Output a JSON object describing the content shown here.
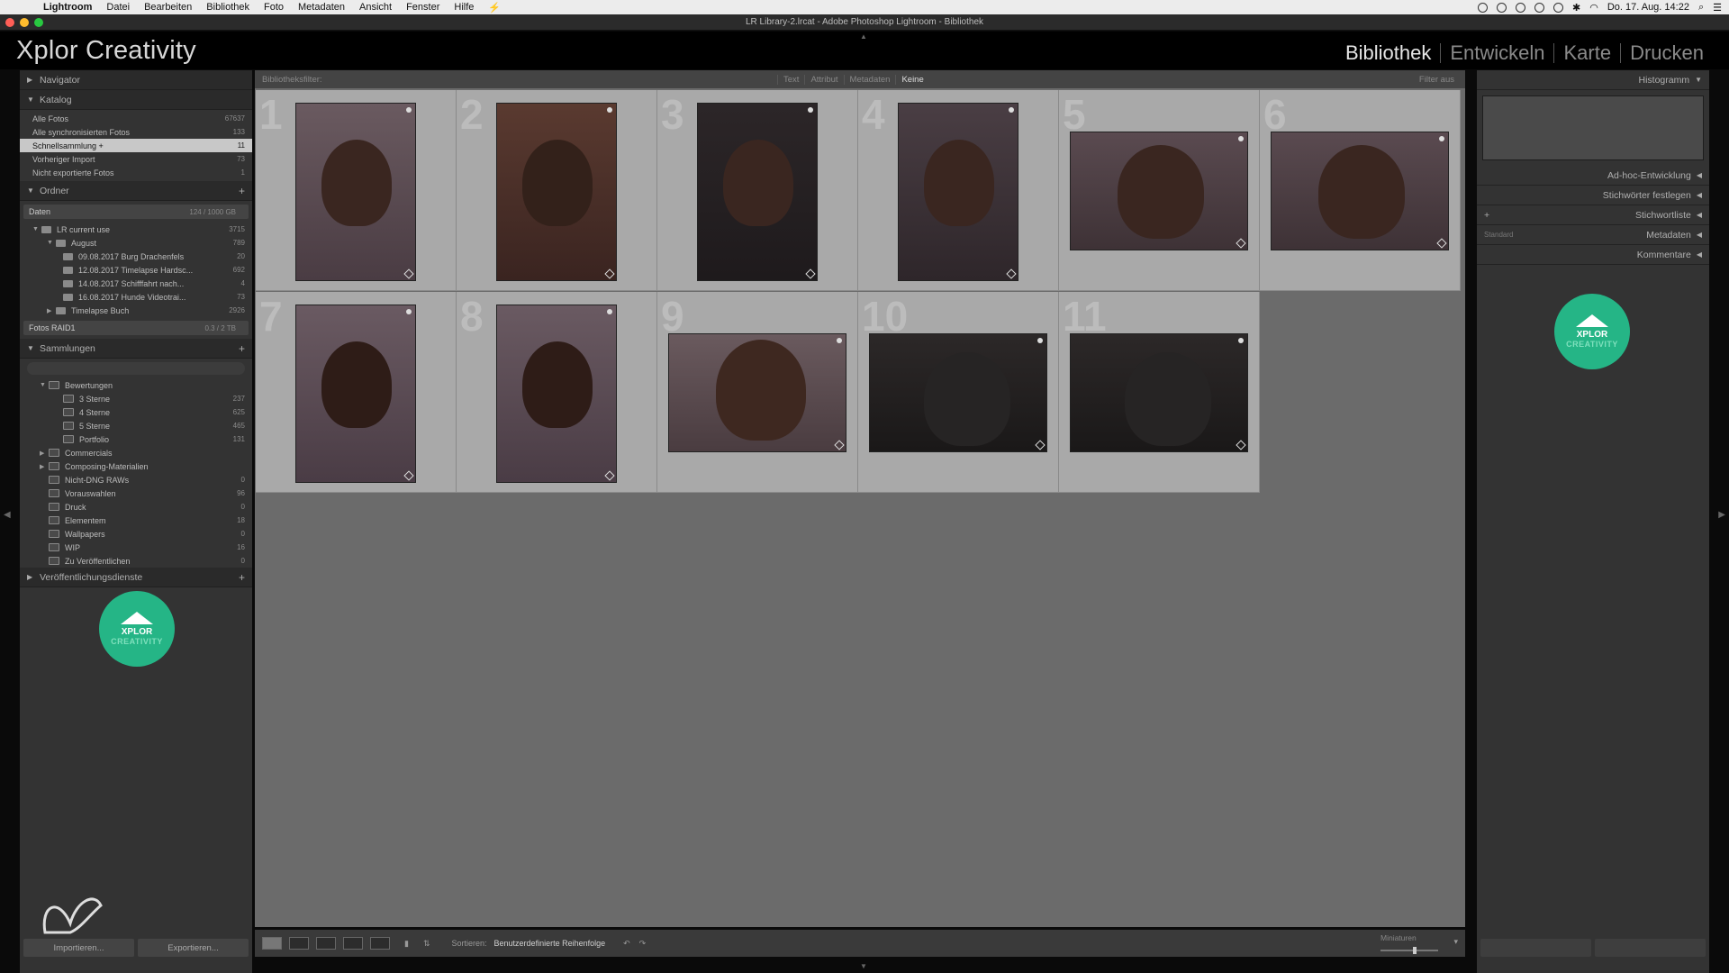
{
  "menubar": {
    "items": [
      "Lightroom",
      "Datei",
      "Bearbeiten",
      "Bibliothek",
      "Foto",
      "Metadaten",
      "Ansicht",
      "Fenster",
      "Hilfe"
    ],
    "clock": "Do. 17. Aug. 14:22"
  },
  "window": {
    "title": "LR Library-2.lrcat - Adobe Photoshop Lightroom - Bibliothek"
  },
  "identity": {
    "brand": "Xplor Creativity",
    "modules": [
      "Bibliothek",
      "Entwickeln",
      "Karte",
      "Drucken"
    ]
  },
  "left": {
    "navigator": "Navigator",
    "katalog": {
      "title": "Katalog",
      "items": [
        {
          "label": "Alle Fotos",
          "count": "67637"
        },
        {
          "label": "Alle synchronisierten Fotos",
          "count": "133"
        },
        {
          "label": "Schnellsammlung +",
          "count": "11"
        },
        {
          "label": "Vorheriger Import",
          "count": "73"
        },
        {
          "label": "Nicht exportierte Fotos",
          "count": "1"
        }
      ]
    },
    "ordner": {
      "title": "Ordner",
      "volume1": {
        "label": "Daten",
        "count": "124 / 1000 GB"
      },
      "items": [
        {
          "label": "LR current use",
          "count": "3715"
        },
        {
          "label": "August",
          "count": "789"
        },
        {
          "label": "09.08.2017 Burg Drachenfels",
          "count": "20"
        },
        {
          "label": "12.08.2017 Timelapse Hardsc...",
          "count": "692"
        },
        {
          "label": "14.08.2017 Schifffahrt nach...",
          "count": "4"
        },
        {
          "label": "16.08.2017 Hunde Videotrai...",
          "count": "73"
        },
        {
          "label": "Timelapse Buch",
          "count": "2926"
        }
      ],
      "volume2": {
        "label": "Fotos RAID1",
        "count": "0.3 / 2 TB"
      }
    },
    "sammlungen": {
      "title": "Sammlungen",
      "items": [
        {
          "label": "Bewertungen",
          "count": ""
        },
        {
          "label": "3 Sterne",
          "count": "237"
        },
        {
          "label": "4 Sterne",
          "count": "625"
        },
        {
          "label": "5 Sterne",
          "count": "465"
        },
        {
          "label": "Portfolio",
          "count": "131"
        },
        {
          "label": "Commercials",
          "count": ""
        },
        {
          "label": "Composing-Materialien",
          "count": ""
        },
        {
          "label": "Nicht-DNG RAWs",
          "count": "0"
        },
        {
          "label": "Vorauswahlen",
          "count": "96"
        },
        {
          "label": "Druck",
          "count": "0"
        },
        {
          "label": "Elementem",
          "count": "18"
        },
        {
          "label": "Wallpapers",
          "count": "0"
        },
        {
          "label": "WIP",
          "count": "16"
        },
        {
          "label": "Zu Veröffentlichen",
          "count": "0"
        }
      ]
    },
    "publish": "Veröffentlichungsdienste",
    "logo": {
      "line1": "XPLOR",
      "line2": "CREATIVITY"
    },
    "import_btn": "Importieren...",
    "export_btn": "Exportieren..."
  },
  "filter": {
    "label": "Bibliotheksfilter:",
    "tabs": [
      "Text",
      "Attribut",
      "Metadaten",
      "Keine"
    ],
    "off": "Filter aus"
  },
  "grid": {
    "cells": [
      "1",
      "2",
      "3",
      "4",
      "5",
      "6",
      "7",
      "8",
      "9",
      "10",
      "11"
    ]
  },
  "toolbar": {
    "sort_label": "Sortieren:",
    "sort_value": "Benutzerdefinierte Reihenfolge",
    "thumbs_label": "Miniaturen",
    "thumb_size": 0.6
  },
  "right": {
    "histogram": "Histogramm",
    "panels": [
      "Ad-hoc-Entwicklung",
      "Stichwörter festlegen",
      "Stichwortliste",
      "Metadaten",
      "Kommentare"
    ],
    "metadata_preset": "Standard"
  }
}
